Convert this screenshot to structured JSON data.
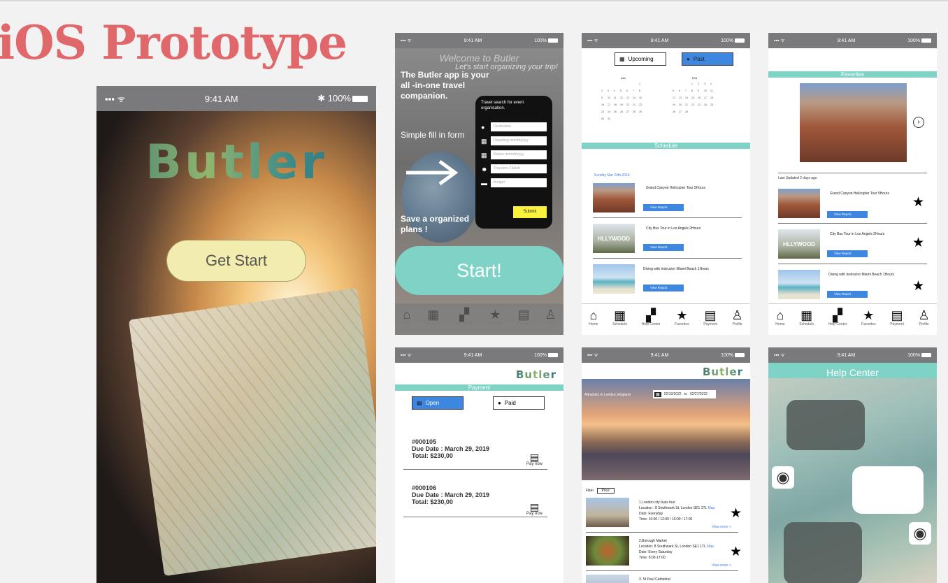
{
  "page_title": "iOS Prototype",
  "status": {
    "time": "9:41 AM",
    "battery": "100%",
    "signal": "▪▪▪ ᯤ"
  },
  "icons": {
    "bluetooth": "bluetooth-icon",
    "battery": "battery-icon"
  },
  "colors": {
    "accent": "#7fd3c6",
    "title": "#e0676a",
    "button": "#3d87e0",
    "submit": "#f8f23c"
  },
  "splash": {
    "logo": "Butler",
    "button": "Get Start"
  },
  "onboarding": {
    "welcome": "Welcome to Butler",
    "slogan": "Let's start organizing your trip!",
    "intro": "The Butler app is your all -in-one travel companion.",
    "fill": "Simple fill in form",
    "save": "Save a organized plans !",
    "form_head": "Travel search for event organisation.",
    "fields": [
      "Destination",
      "Departing mm/dd/yyyy",
      "Return mm/dd/yyyy",
      "Travelers 2 Adult",
      "Budget"
    ],
    "submit": "Submit",
    "start": "Start!"
  },
  "tabs": [
    "Home",
    "Schedule",
    "Help Center",
    "Favorites",
    "Payment",
    "Profile"
  ],
  "schedule": {
    "seg_upcoming": "Upcoming",
    "seg_past": "Past",
    "months": [
      "Jan",
      "Feb"
    ],
    "header": "Schedule",
    "date": "Sunday Mar 24th,2019",
    "items": [
      {
        "title": "Grand Canyon Helicopter Tour 5Hours",
        "action": "View Report"
      },
      {
        "title": "City Bus Tour in Los Angels 2Hours",
        "action": "View Report"
      },
      {
        "title": "Diving with instructor Miami Beach 1Hours",
        "action": "View Report"
      }
    ]
  },
  "favorites": {
    "header": "Favorites",
    "updated": "Last Updated 2 days ago",
    "items": [
      {
        "title": "Grand Canyon Helicopter Tour 5Hours",
        "action": "View Report"
      },
      {
        "title": "City Bus Tour in Los Angels 2Hours",
        "action": "View Report"
      },
      {
        "title": "Diving with instructor Miami Beach 1Hours",
        "action": "View Report"
      }
    ]
  },
  "payment": {
    "logo": "Butler",
    "header": "Payment",
    "seg_open": "Open",
    "seg_paid": "Paid",
    "invoices": [
      {
        "id": "#000105",
        "due": "Due Date : March 29, 2019",
        "total": "Total: $230,00",
        "action": "Pay now"
      },
      {
        "id": "#000106",
        "due": "Due Date : March 29, 2019",
        "total": "Total: $230,00",
        "action": "Pay now"
      }
    ]
  },
  "attractions": {
    "logo": "Butler",
    "location": "Attraction in London, England",
    "from": "02/19/2022",
    "to_word": "to",
    "to": "02/27/2022",
    "filter_label": "Filter",
    "filter_value": "Price",
    "items": [
      {
        "title": "1.London city buss tour",
        "location": "Location : 8 Southwark St, London SE1 1TL",
        "map": "Map",
        "date": "Date: Everyday",
        "time": "Time: 10:00 / 12:00 / 15:00 / 17:00",
        "more": "View more >"
      },
      {
        "title": "2.Borough Market",
        "location": "Location: 8 Southwark St, London SE1 1TL",
        "map": "Map",
        "date": "Date: Every Saturday",
        "time": "Time: 8:00-17:00",
        "more": "View more >"
      },
      {
        "title": "3. St Paul Cathedral",
        "location": "",
        "map": "",
        "date": "",
        "time": "",
        "more": ""
      }
    ]
  },
  "help": {
    "header": "Help Center"
  }
}
